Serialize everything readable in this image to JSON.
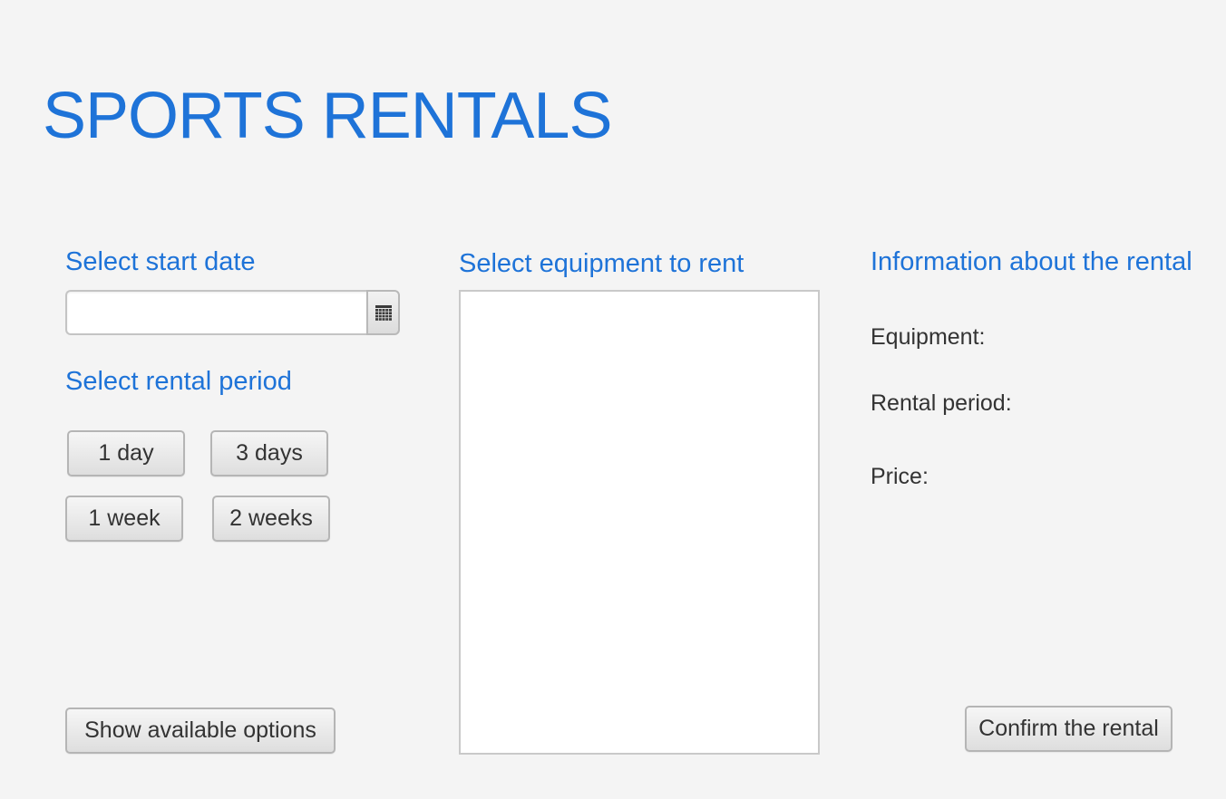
{
  "app": {
    "title": "SPORTS RENTALS"
  },
  "start_date": {
    "heading": "Select start date",
    "value": "",
    "placeholder": "",
    "calendar_icon": "calendar-icon"
  },
  "rental_period": {
    "heading": "Select rental period",
    "options": [
      "1 day",
      "3 days",
      "1 week",
      "2 weeks"
    ]
  },
  "show_options": {
    "label": "Show available options"
  },
  "equipment": {
    "heading": "Select equipment to rent",
    "items": []
  },
  "info": {
    "heading": "Information about the rental",
    "equipment_label": "Equipment:",
    "rental_period_label": "Rental period:",
    "price_label": "Price:"
  },
  "confirm": {
    "label": "Confirm the rental"
  },
  "colors": {
    "accent": "#1e73d8",
    "background": "#f4f4f4",
    "text": "#333333"
  }
}
